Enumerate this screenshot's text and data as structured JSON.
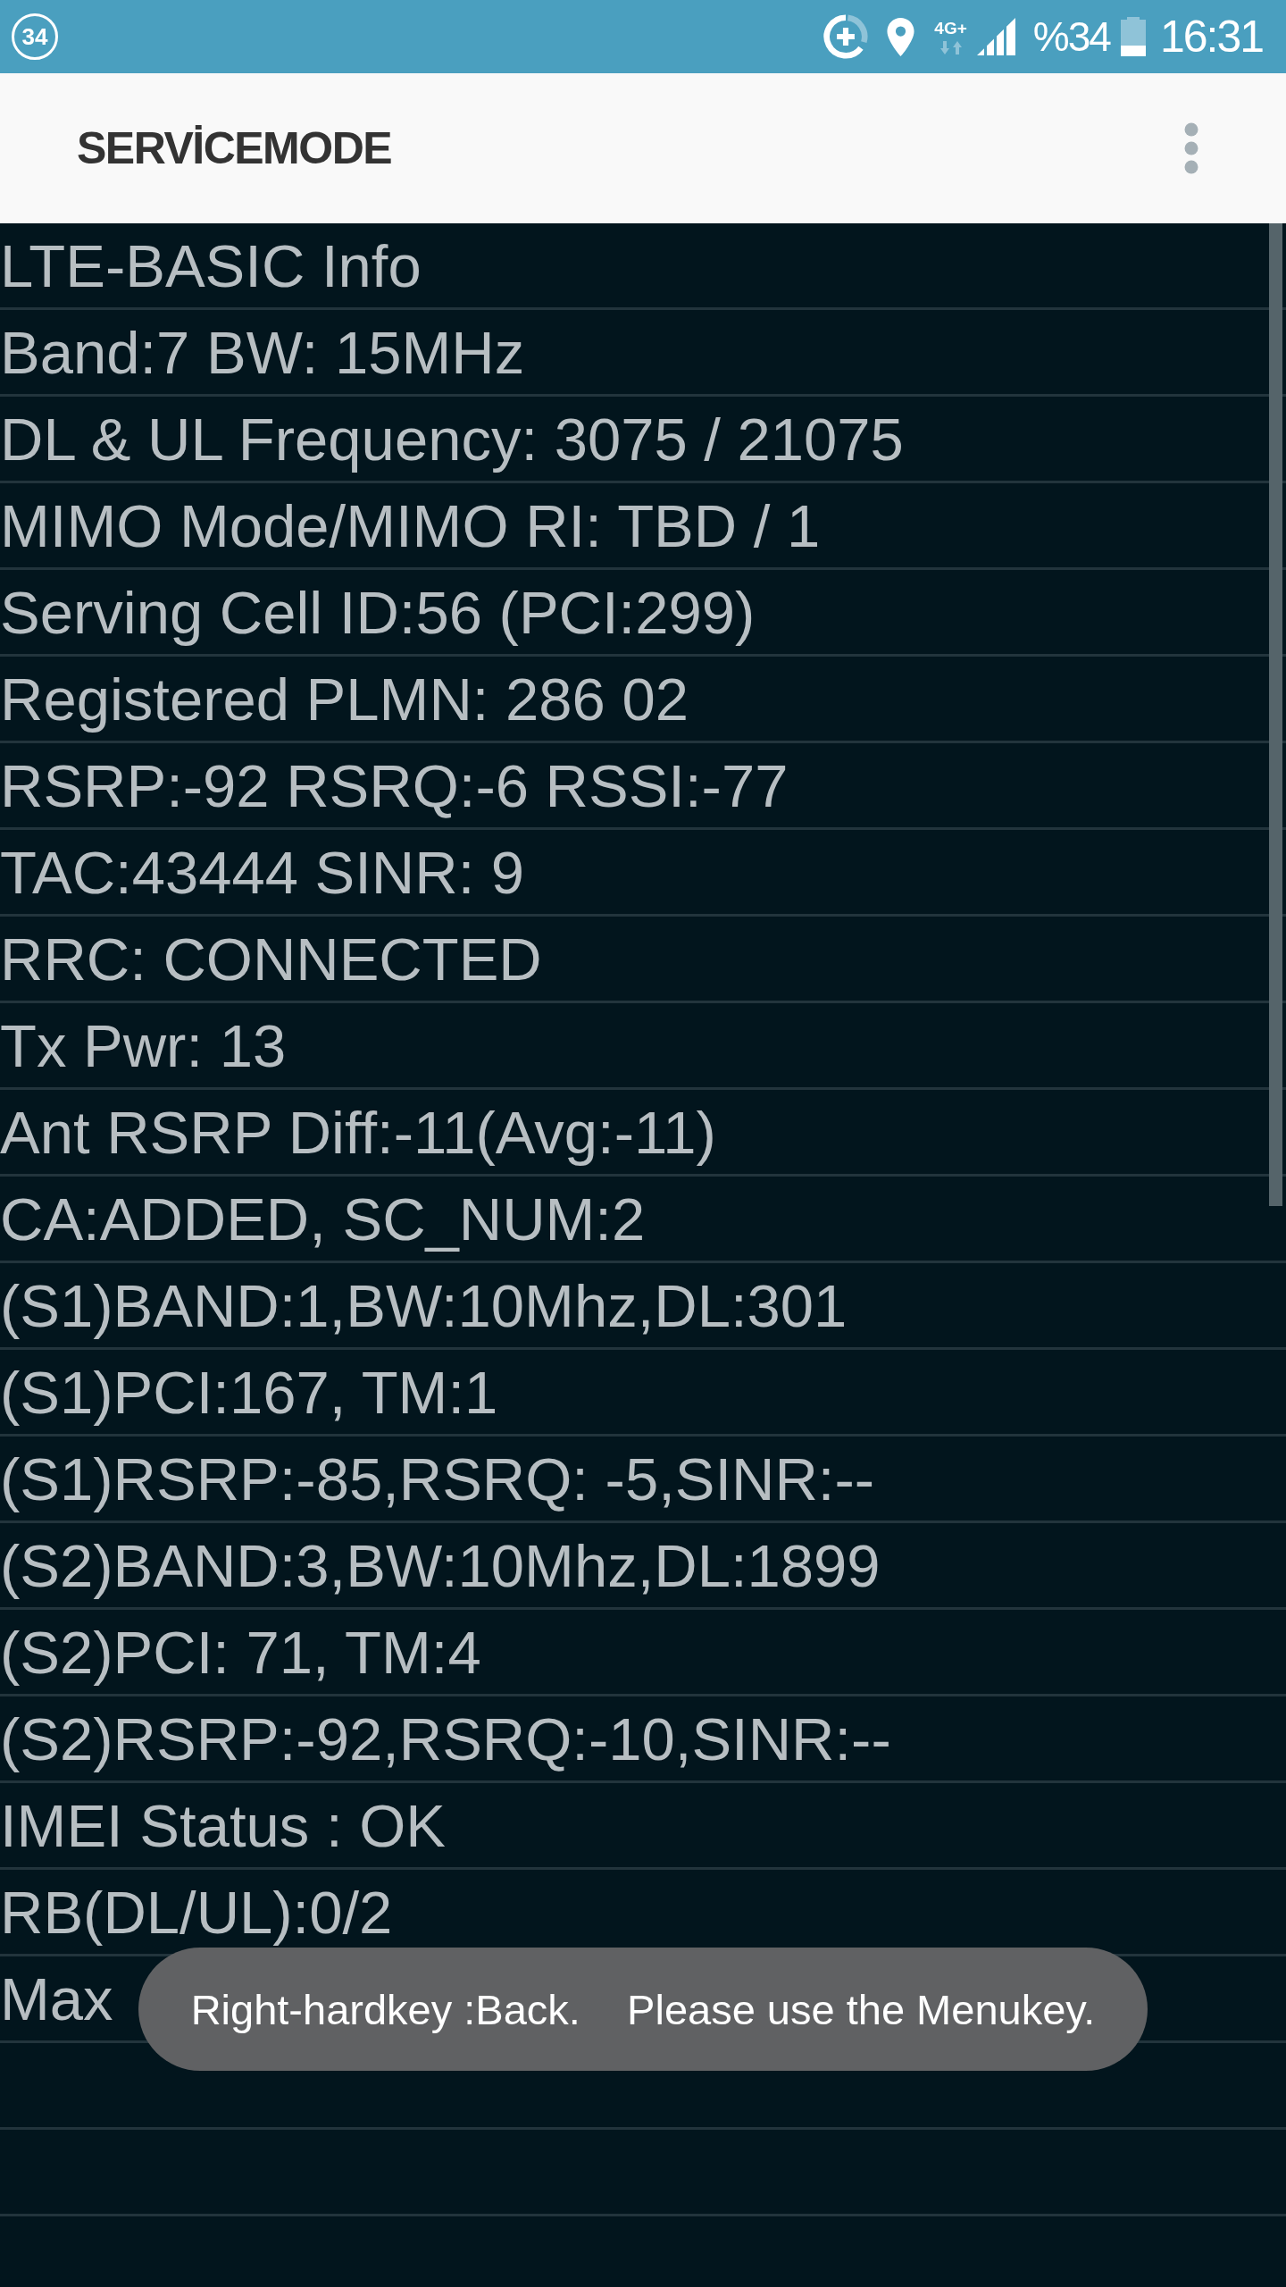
{
  "status_bar": {
    "notification_count": "34",
    "network_type": "4G+",
    "battery_percent": "%34",
    "time": "16:31"
  },
  "app_bar": {
    "title": "SERVİCEMODE"
  },
  "info_rows": [
    "LTE-BASIC Info",
    "Band:7 BW: 15MHz",
    "DL & UL Frequency: 3075 / 21075",
    "MIMO Mode/MIMO RI: TBD / 1",
    "Serving Cell ID:56 (PCI:299)",
    "Registered PLMN: 286 02",
    "RSRP:-92 RSRQ:-6 RSSI:-77",
    "TAC:43444 SINR: 9",
    "RRC: CONNECTED",
    "Tx Pwr: 13",
    "Ant RSRP Diff:-11(Avg:-11)",
    "CA:ADDED, SC_NUM:2",
    "(S1)BAND:1,BW:10Mhz,DL:301",
    "(S1)PCI:167, TM:1",
    "(S1)RSRP:-85,RSRQ: -5,SINR:--",
    "(S2)BAND:3,BW:10Mhz,DL:1899",
    "(S2)PCI: 71, TM:4",
    "(S2)RSRP:-92,RSRQ:-10,SINR:--",
    "IMEI Status : OK",
    "RB(DL/UL):0/2",
    "Max"
  ],
  "toast": {
    "text": "Right-hardkey :Back.    Please use the Menukey."
  }
}
